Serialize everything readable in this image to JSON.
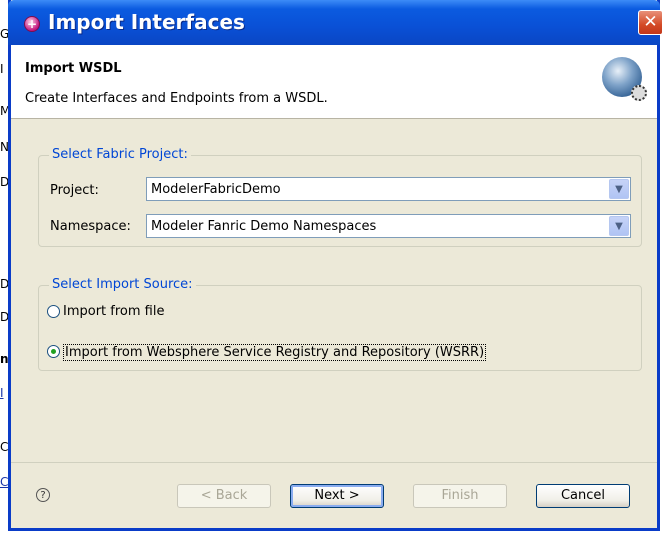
{
  "background": {
    "fragments": [
      "Ge",
      "I",
      "M",
      "N",
      "D",
      "D",
      "D",
      "n",
      "I",
      "Co",
      "C"
    ]
  },
  "dialog": {
    "title": "Import Interfaces",
    "close_glyph": "✕"
  },
  "header": {
    "title": "Import WSDL",
    "description": "Create Interfaces and Endpoints from a WSDL."
  },
  "fabric_group": {
    "label": "Select Fabric Project:",
    "project_label": "Project:",
    "project_value": "ModelerFabricDemo",
    "namespace_label": "Namespace:",
    "namespace_value": "Modeler Fanric Demo Namespaces"
  },
  "source_group": {
    "label": "Select Import Source:",
    "option_file": "Import from file",
    "option_wsrr": "Import from Websphere Service Registry and Repository (WSRR)",
    "selected": "wsrr"
  },
  "footer": {
    "help_glyph": "?",
    "back_label": "< Back",
    "next_label": "Next >",
    "finish_label": "Finish",
    "cancel_label": "Cancel"
  },
  "colors": {
    "title_bar": "#0a50d6",
    "group_label": "#0046d5",
    "dialog_bg": "#ece9d8"
  },
  "icons": [
    "app-icon",
    "close-icon",
    "globe-gear-icon",
    "chevron-down-icon",
    "help-icon"
  ]
}
